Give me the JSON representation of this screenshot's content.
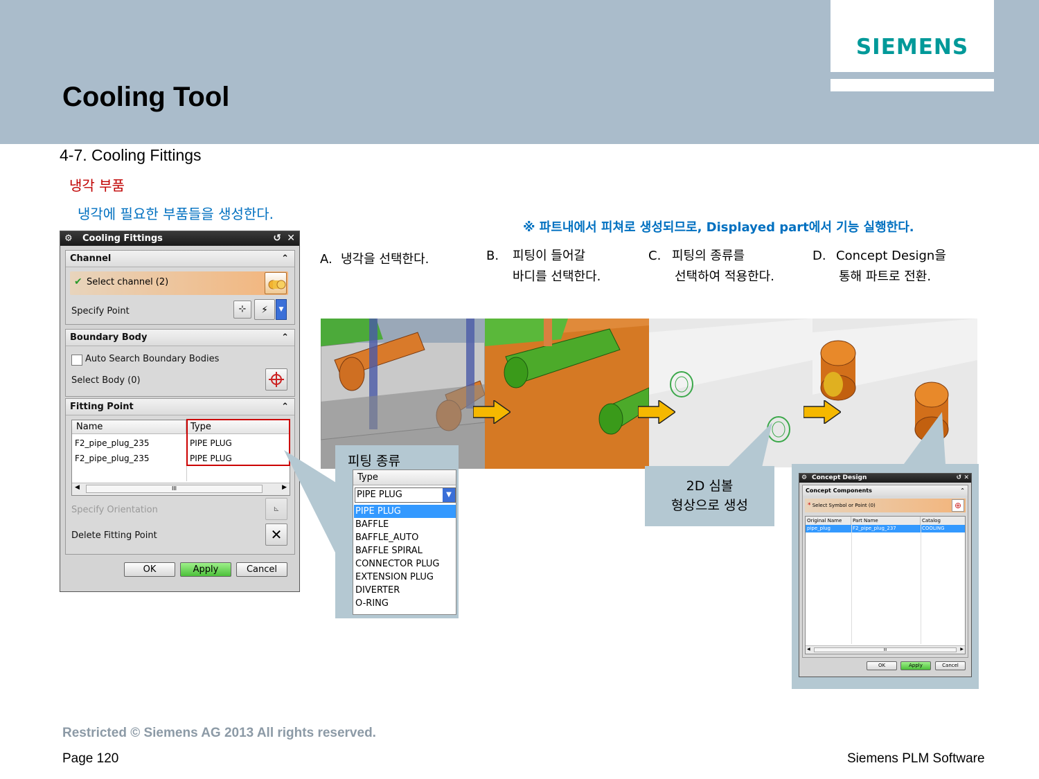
{
  "slide": {
    "title": "Cooling Tool",
    "brand": "SIEMENS",
    "section": "4-7.  Cooling Fittings",
    "subtitle_red": "냉각 부품",
    "subtitle_blue": "냉각에 필요한 부품들을 생성한다.",
    "note": "※ 파트내에서 피쳐로 생성되므로, Displayed part에서 기능 실행한다.",
    "footer_copyright": "Restricted © Siemens AG 2013 All rights reserved.",
    "footer_page": "Page 120",
    "footer_company": "Siemens PLM Software"
  },
  "steps": [
    {
      "letter": "A.",
      "line1": "냉각을 선택한다.",
      "line2": ""
    },
    {
      "letter": "B.",
      "line1": "피팅이 들어갈",
      "line2": "바디를 선택한다."
    },
    {
      "letter": "C.",
      "line1": "피팅의 종류를",
      "line2": "선택하여 적용한다."
    },
    {
      "letter": "D.",
      "line1": "Concept Design을",
      "line2": "통해 파트로 전환."
    }
  ],
  "dialog": {
    "title": "Cooling Fittings",
    "channel": {
      "header": "Channel",
      "select_channel": "Select channel (2)",
      "specify_point": "Specify Point"
    },
    "boundary": {
      "header": "Boundary Body",
      "auto_search": "Auto Search Boundary Bodies",
      "select_body": "Select Body (0)"
    },
    "fitting": {
      "header": "Fitting Point",
      "columns": [
        "Name",
        "Type"
      ],
      "rows": [
        {
          "name": "F2_pipe_plug_235",
          "type": "PIPE PLUG"
        },
        {
          "name": "F2_pipe_plug_235",
          "type": "PIPE PLUG"
        }
      ],
      "scroll_mark": "III",
      "specify_orientation": "Specify Orientation",
      "delete_point": "Delete Fitting Point"
    },
    "buttons": {
      "ok": "OK",
      "apply": "Apply",
      "cancel": "Cancel"
    }
  },
  "fitting_type_panel": {
    "title": "피팅 종류",
    "label": "Type",
    "selected": "PIPE PLUG",
    "options": [
      "PIPE PLUG",
      "BAFFLE",
      "BAFFLE_AUTO",
      "BAFFLE SPIRAL",
      "CONNECTOR PLUG",
      "EXTENSION PLUG",
      "DIVERTER",
      "O-RING"
    ]
  },
  "symbol_note": {
    "line1": "2D 심볼",
    "line2": "형상으로 생성"
  },
  "concept_design": {
    "title": "Concept Design",
    "group": "Concept Components",
    "select": "Select Symbol or Point (0)",
    "columns": [
      "Original Name",
      "Part Name",
      "Catalog"
    ],
    "row": {
      "original": "pipe_plug",
      "part": "F2_pipe_plug_237",
      "catalog": "COOLING"
    },
    "scroll_mark": "III",
    "buttons": {
      "ok": "OK",
      "apply": "Apply",
      "cancel": "Cancel"
    }
  },
  "colors": {
    "header_bg": "#aabccb",
    "brand": "#009999",
    "accent_red": "#c00000",
    "accent_blue": "#0070c0",
    "callout_bg": "#b4c8d2",
    "highlight_red": "#cc0000",
    "selection_blue": "#3399ff"
  }
}
